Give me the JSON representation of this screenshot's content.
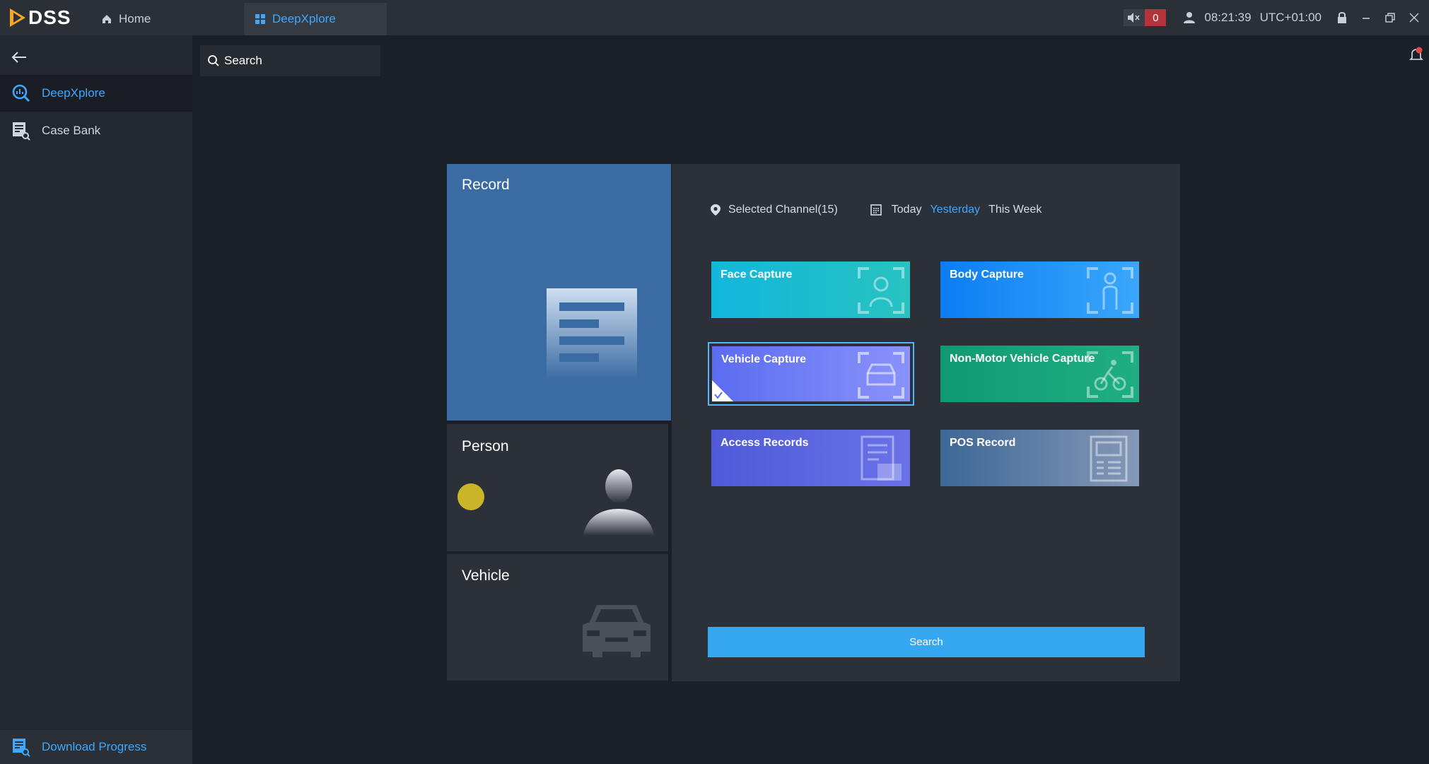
{
  "app": {
    "logo": "DSS"
  },
  "tabs": [
    {
      "label": "Home",
      "icon": "home-icon"
    },
    {
      "label": "DeepXplore",
      "icon": "grid-icon"
    }
  ],
  "status": {
    "mute_count": "0",
    "time": "08:21:39",
    "timezone": "UTC+01:00"
  },
  "sidebar": {
    "items": [
      {
        "label": "DeepXplore",
        "icon": "deepxplore-icon"
      },
      {
        "label": "Case Bank",
        "icon": "case-bank-icon"
      }
    ],
    "bottom": {
      "label": "Download Progress",
      "icon": "download-progress-icon"
    }
  },
  "search_tab": {
    "label": "Search"
  },
  "tiles": {
    "record": "Record",
    "person": "Person",
    "vehicle": "Vehicle"
  },
  "filters": {
    "channel": "Selected Channel(15)",
    "today": "Today",
    "yesterday": "Yesterday",
    "this_week": "This Week",
    "active": "Yesterday"
  },
  "cards": {
    "face": "Face Capture",
    "body": "Body Capture",
    "vehicle": "Vehicle Capture",
    "non_motor": "Non-Motor Vehicle Capture",
    "access": "Access Records",
    "pos": "POS Record"
  },
  "selected_card": "Vehicle Capture",
  "search_button": "Search",
  "colors": {
    "accent": "#3ea8ff",
    "button": "#36a8f2",
    "alert": "#b5343c"
  }
}
